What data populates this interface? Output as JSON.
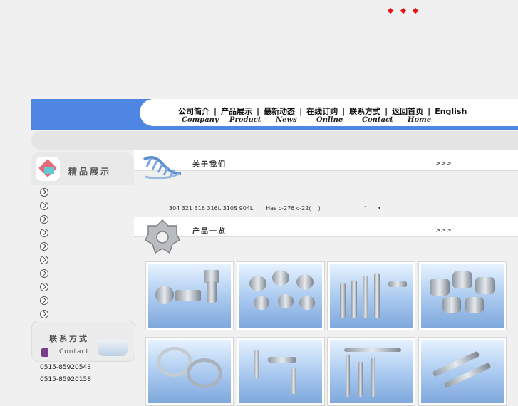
{
  "nav": {
    "items": [
      {
        "zh": "公司简介",
        "en": "Company"
      },
      {
        "zh": "产品展示",
        "en": "Product"
      },
      {
        "zh": "最新动态",
        "en": "News"
      },
      {
        "zh": "在线订购",
        "en": "Online"
      },
      {
        "zh": "联系方式",
        "en": "Contact"
      },
      {
        "zh": "返回首页",
        "en": "Home"
      }
    ],
    "english_label": "English",
    "separator": "|"
  },
  "left": {
    "featured_title": "精品展示",
    "contact_title": "联系方式",
    "contact_en": "Contact",
    "phones": [
      "0515-85920543",
      "0515-85920158"
    ]
  },
  "about": {
    "title": "关于我们",
    "more": ">>>",
    "text": "304 321 316 316L 310S 904L       Has c-276 c-22(    )                        “      •"
  },
  "products": {
    "title": "产品一览",
    "more": ">>>"
  },
  "colors": {
    "nav_blue": "#4f86e3",
    "accent_red": "#e81010"
  }
}
